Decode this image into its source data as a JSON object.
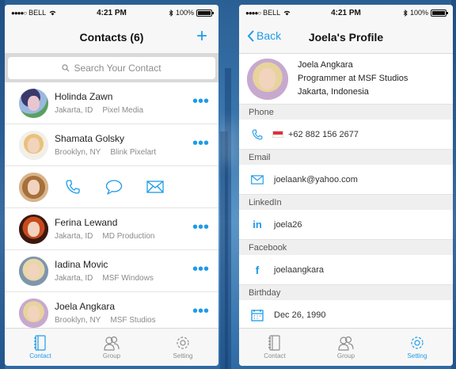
{
  "status": {
    "carrier": "BELL",
    "time": "4:21 PM",
    "battery": "100%"
  },
  "contacts_screen": {
    "title": "Contacts (6)",
    "add_label": "+",
    "search_placeholder": "Search Your Contact",
    "more_label": "•••",
    "contacts": [
      {
        "name": "Holinda Zawn",
        "city": "Jakarta, ID",
        "company": "Pixel Media"
      },
      {
        "name": "Shamata Golsky",
        "city": "Brooklyn, NY",
        "company": "Blink Pixelart"
      },
      {
        "name": "Ferina Lewand",
        "city": "Jakarta, ID",
        "company": "MD Production"
      },
      {
        "name": "Iadina Movic",
        "city": "Jakarta, ID",
        "company": "MSF Windows"
      },
      {
        "name": "Joela Angkara",
        "city": "Brooklyn, NY",
        "company": "MSF Studios"
      }
    ],
    "action_icons": [
      "phone-icon",
      "chat-bubble-icon",
      "mail-icon"
    ]
  },
  "profile_screen": {
    "back_label": "Back",
    "title": "Joela's Profile",
    "name": "Joela Angkara",
    "job": "Programmer at MSF Studios",
    "location": "Jakarta, Indonesia",
    "sections": {
      "phone": {
        "header": "Phone",
        "value": "+62 882 156 2677"
      },
      "email": {
        "header": "Email",
        "value": "joelaank@yahoo.com"
      },
      "linkedin": {
        "header": "LinkedIn",
        "value": "joela26"
      },
      "facebook": {
        "header": "Facebook",
        "value": "joelaangkara"
      },
      "birthday": {
        "header": "Birthday",
        "value": "Dec 26, 1990"
      }
    }
  },
  "tabbar": {
    "contact": "Contact",
    "group": "Group",
    "setting": "Setting"
  },
  "colors": {
    "accent": "#1e9be8",
    "background": "#3b78b0"
  }
}
